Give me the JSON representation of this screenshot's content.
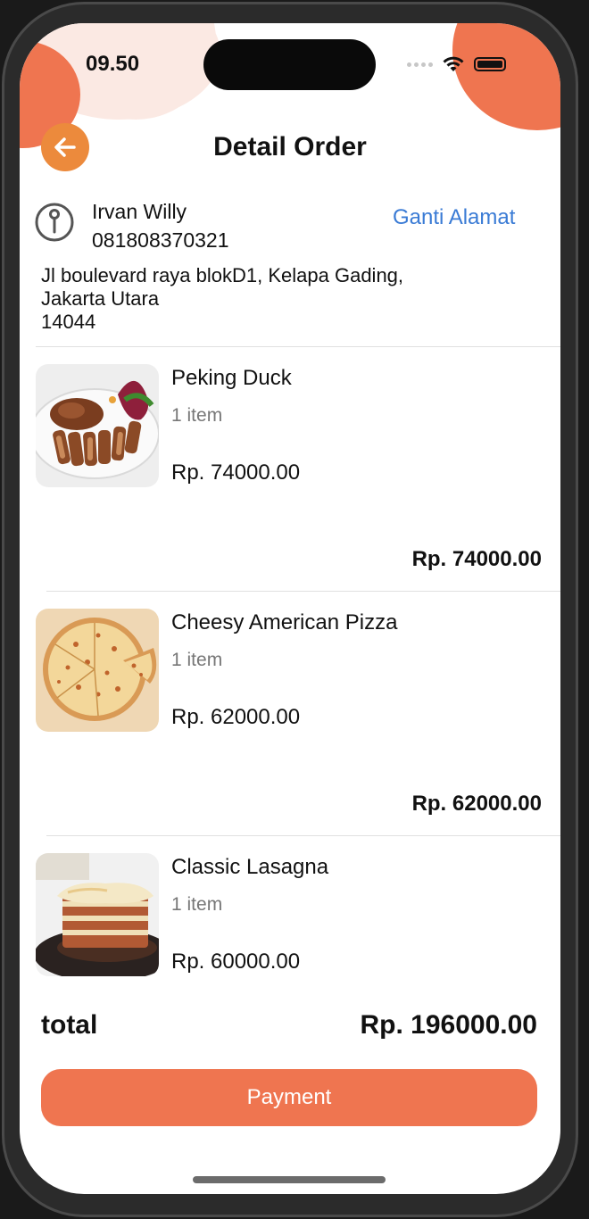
{
  "status_bar": {
    "time": "09.50"
  },
  "header": {
    "title": "Detail Order",
    "back_icon": "arrow-left-icon"
  },
  "address": {
    "name": "Irvan Willy",
    "phone": "081808370321",
    "change_label": "Ganti Alamat",
    "lines": [
      "Jl boulevard raya blokD1, Kelapa Gading,",
      "Jakarta Utara",
      "14044"
    ]
  },
  "items": [
    {
      "name": "Peking Duck",
      "qty": "1 item",
      "price": "Rp. 74000.00",
      "subtotal": "Rp. 74000.00"
    },
    {
      "name": "Cheesy American Pizza",
      "qty": "1 item",
      "price": "Rp. 62000.00",
      "subtotal": "Rp. 62000.00"
    },
    {
      "name": "Classic Lasagna",
      "qty": "1 item",
      "price": "Rp. 60000.00"
    }
  ],
  "summary": {
    "total_label": "total",
    "total_value": "Rp. 196000.00"
  },
  "payment_button": "Payment",
  "colors": {
    "accent": "#ef7550",
    "back_button": "#ec8a3c",
    "link": "#3a7bd5"
  }
}
